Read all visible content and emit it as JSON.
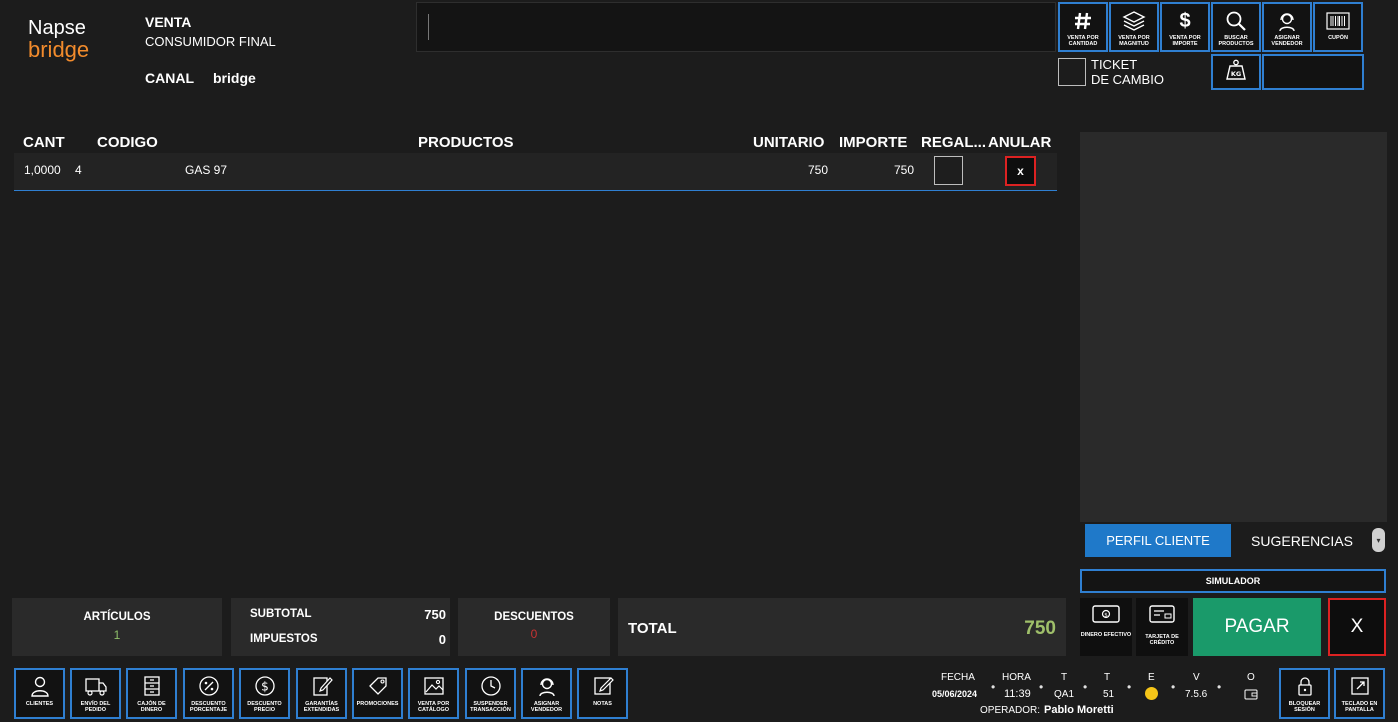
{
  "brand": {
    "line1": "Napse",
    "line2": "bridge"
  },
  "sale": {
    "title": "VENTA",
    "client": "CONSUMIDOR FINAL",
    "canal_label": "CANAL",
    "canal_value": "bridge"
  },
  "scan": {
    "value": ""
  },
  "top_actions": [
    {
      "id": "venta-por-cantidad",
      "label": "VENTA POR CANTIDAD",
      "icon": "hash-icon"
    },
    {
      "id": "venta-por-magnitud",
      "label": "VENTA POR MAGNITUD",
      "icon": "layers-icon"
    },
    {
      "id": "venta-por-importe",
      "label": "VENTA POR IMPORTE",
      "icon": "dollar-icon"
    },
    {
      "id": "buscar-productos",
      "label": "BUSCAR PRODUCTOS",
      "icon": "search-icon"
    },
    {
      "id": "asignar-vendedor",
      "label": "ASIGNAR VENDEDOR",
      "icon": "headset-icon"
    },
    {
      "id": "cupon",
      "label": "CUPÓN",
      "icon": "barcode-icon"
    }
  ],
  "ticket_cambio": {
    "line1": "TICKET",
    "line2": "DE CAMBIO"
  },
  "table": {
    "headers": {
      "cant": "CANT",
      "codigo": "CODIGO",
      "productos": "PRODUCTOS",
      "unitario": "UNITARIO",
      "importe": "IMPORTE",
      "regalo": "REGAL...",
      "anular": "ANULAR"
    },
    "rows": [
      {
        "cant": "1,0000",
        "codigo": "4",
        "producto": "GAS 97",
        "unitario": "750",
        "importe": "750",
        "anular": "x"
      }
    ]
  },
  "side_tabs": {
    "perfil": "PERFIL CLIENTE",
    "sugerencias": "SUGERENCIAS"
  },
  "simulador": "SIMULADOR",
  "totals": {
    "articulos_label": "ARTÍCULOS",
    "articulos_value": "1",
    "subtotal_label": "SUBTOTAL",
    "subtotal_value": "750",
    "impuestos_label": "IMPUESTOS",
    "impuestos_value": "0",
    "descuentos_label": "DESCUENTOS",
    "descuentos_value": "0",
    "total_label": "TOTAL",
    "total_value": "750"
  },
  "payments": {
    "efectivo": "DINERO EFECTIVO",
    "tarjeta": "TARJETA DE CRÉDITO",
    "pagar": "PAGAR",
    "cancel": "X"
  },
  "bottom_actions": [
    {
      "id": "clientes",
      "label": "CLIENTES",
      "icon": "user-icon"
    },
    {
      "id": "envio-del-pedido",
      "label": "ENVÍO DEL PEDIDO",
      "icon": "truck-icon"
    },
    {
      "id": "cajon-de-dinero",
      "label": "CAJÓN DE DINERO",
      "icon": "drawer-icon"
    },
    {
      "id": "descuento-porcentaje",
      "label": "DESCUENTO PORCENTAJE",
      "icon": "percent-icon"
    },
    {
      "id": "descuento-precio",
      "label": "DESCUENTO PRECIO",
      "icon": "coin-icon"
    },
    {
      "id": "garantias-extendidas",
      "label": "GARANTÍAS EXTENDIDAS",
      "icon": "document-edit-icon"
    },
    {
      "id": "promociones",
      "label": "PROMOCIONES",
      "icon": "tag-icon"
    },
    {
      "id": "venta-por-catalogo",
      "label": "VENTA POR CATÁLOGO",
      "icon": "image-icon"
    },
    {
      "id": "suspender-transaccion",
      "label": "SUSPENDER TRANSACCIÓN",
      "icon": "clock-icon"
    },
    {
      "id": "asignar-vendedor-bottom",
      "label": "ASIGNAR VENDEDOR",
      "icon": "headset-icon"
    },
    {
      "id": "notas",
      "label": "NOTAS",
      "icon": "note-icon"
    }
  ],
  "status": {
    "fecha_label": "FECHA",
    "fecha_value": "05/06/2024",
    "hora_label": "HORA",
    "hora_value": "11:39",
    "t1_label": "T",
    "t1_value": "QA1",
    "t2_label": "T",
    "t2_value": "51",
    "e_label": "E",
    "v_label": "V",
    "v_value": "7.5.6",
    "o_label": "O",
    "operador_label": "OPERADOR:",
    "operador_value": "Pablo Moretti",
    "status_color": "#f5c518"
  },
  "right_actions": {
    "bloquear": "BLOQUEAR SESIÓN",
    "teclado": "TECLADO EN PANTALLA"
  },
  "colors": {
    "accent": "#2f7fd1",
    "pay": "#1a9a6a",
    "danger": "#dd2222",
    "total": "#9fbf6a",
    "descuento": "#c83232"
  }
}
